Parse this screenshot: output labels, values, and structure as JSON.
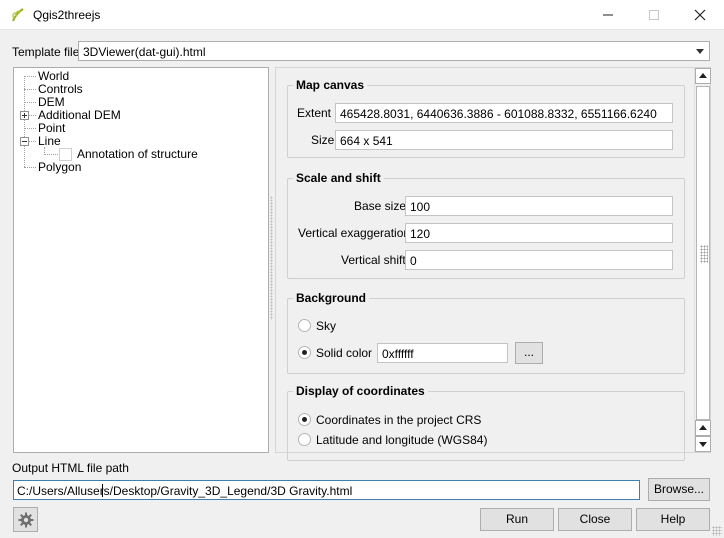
{
  "window": {
    "title": "Qgis2threejs"
  },
  "template": {
    "label": "Template file",
    "value": "3DViewer(dat-gui).html"
  },
  "tree": {
    "items": [
      {
        "label": "World"
      },
      {
        "label": "Controls"
      },
      {
        "label": "DEM"
      },
      {
        "label": "Additional DEM"
      },
      {
        "label": "Point"
      },
      {
        "label": "Line"
      },
      {
        "label": "Annotation of structure"
      },
      {
        "label": "Polygon"
      }
    ]
  },
  "map_canvas": {
    "title": "Map canvas",
    "extent_label": "Extent",
    "extent_value": "465428.8031, 6440636.3886 - 601088.8332, 6551166.6240",
    "size_label": "Size",
    "size_value": "664 x 541"
  },
  "scale_shift": {
    "title": "Scale and shift",
    "base_size_label": "Base size",
    "base_size_value": "100",
    "vert_exag_label": "Vertical exaggeration",
    "vert_exag_value": "120",
    "vert_shift_label": "Vertical shift",
    "vert_shift_value": "0"
  },
  "background": {
    "title": "Background",
    "sky_label": "Sky",
    "solid_label": "Solid color",
    "color_value": "0xffffff",
    "dots_label": "...",
    "selected": "Solid color"
  },
  "coordinates": {
    "title": "Display of coordinates",
    "project_crs_label": "Coordinates in the project CRS",
    "latlon_label": "Latitude and longitude (WGS84)",
    "selected": "Coordinates in the project CRS"
  },
  "output": {
    "label": "Output HTML file path",
    "path": "C:/Users/Allusers/Desktop/Gravity_3D_Legend/3D Gravity.html",
    "browse_label": "Browse..."
  },
  "buttons": {
    "run": "Run",
    "close": "Close",
    "help": "Help"
  },
  "colors": {
    "accent_border": "#3c7fb1",
    "logo_green": "#93b023"
  },
  "icons": [
    "qgis-logo-icon",
    "minimize-icon",
    "maximize-icon",
    "close-icon",
    "gear-icon"
  ]
}
